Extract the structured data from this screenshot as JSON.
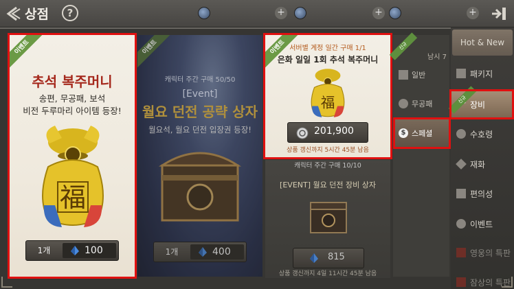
{
  "header": {
    "title": "상점",
    "help": "?"
  },
  "cards": [
    {
      "ribbon": "이벤트",
      "title": "추석 복주머니",
      "desc_line1": "송편, 무공패, 보석",
      "desc_line2": "비전 두루마리 아이템 등장!",
      "qty": "1개",
      "price": "100"
    },
    {
      "ribbon": "이벤트",
      "limit": "캐릭터 주간 구매 50/50",
      "event_tag": "[Event]",
      "title": "월요 던전 공략 상자",
      "desc": "월요석, 월요 던전 입장권 등장!",
      "qty": "1개",
      "price": "400"
    },
    {
      "ribbon": "이벤트",
      "limit": "서버별 계정 일간 구매 1/1",
      "title": "은화 일일 1회 추석 복주머니",
      "price": "201,900",
      "footer": "상품 갱신까지 5시간 45분 남음"
    },
    {
      "limit": "캐릭터 주간 구매 10/10",
      "title": "[EVENT] 월요 던전 장비 상자",
      "price": "815",
      "footer": "상품 갱신까지 4일 11시간 45분 남음"
    }
  ],
  "subnav": {
    "ribbon": "신규",
    "partial_text": "남시 7",
    "items": [
      {
        "label": "일반"
      },
      {
        "label": "무공패"
      },
      {
        "label": "스페셜"
      }
    ]
  },
  "rightnav": {
    "hot_new": "Hot & New",
    "items": [
      {
        "label": "패키지"
      },
      {
        "label": "장비",
        "ribbon": "신규"
      },
      {
        "label": "수호령"
      },
      {
        "label": "재화"
      },
      {
        "label": "편의성"
      },
      {
        "label": "이벤트"
      },
      {
        "label": "영웅의 특판"
      },
      {
        "label": "잠상의 특판"
      }
    ]
  },
  "colors": {
    "highlight": "#e01010",
    "ribbon_green": "#6b9a45",
    "title_red": "#a5281c"
  }
}
